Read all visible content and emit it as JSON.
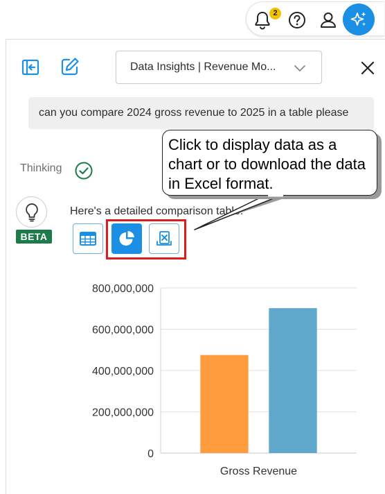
{
  "topbar": {
    "notifications": {
      "icon": "bell-icon",
      "count": "2"
    },
    "help_icon": "question-icon",
    "profile_icon": "user-icon",
    "ai_icon": "sparkle-icon",
    "accent": "#1a8fe3",
    "badge_color": "#f2c200"
  },
  "header": {
    "collapse_icon": "collapse-left-icon",
    "new_chat_icon": "edit-icon",
    "dropdown": {
      "selected": "Data Insights | Revenue Mo..."
    },
    "close_icon": "close-icon"
  },
  "conversation": {
    "user_message": "can you compare 2024 gross revenue to 2025 in a table please",
    "thinking_label": "Thinking",
    "assistant_badge": "BETA",
    "assistant_reply": "Here's a detailed comparison table:",
    "view_buttons": [
      {
        "name": "table-view",
        "icon": "table-icon"
      },
      {
        "name": "chart-view",
        "icon": "pie-chart-icon",
        "active": true
      },
      {
        "name": "excel-download",
        "icon": "excel-icon"
      }
    ]
  },
  "callout": {
    "text": "Click to display data as a chart or to download the data in Excel format."
  },
  "chart_data": {
    "type": "bar",
    "categories": [
      "Gross Revenue"
    ],
    "series": [
      {
        "values": [
          475000000
        ],
        "color": "#ff9d3e"
      },
      {
        "values": [
          702000000
        ],
        "color": "#5fa8cc"
      }
    ],
    "ylim": [
      0,
      800000000
    ],
    "yticks": [
      "0",
      "200,000,000",
      "400,000,000",
      "600,000,000",
      "800,000,000"
    ],
    "ytick_values": [
      0,
      200000000,
      400000000,
      600000000,
      800000000
    ],
    "grid": true,
    "legend": "none"
  }
}
